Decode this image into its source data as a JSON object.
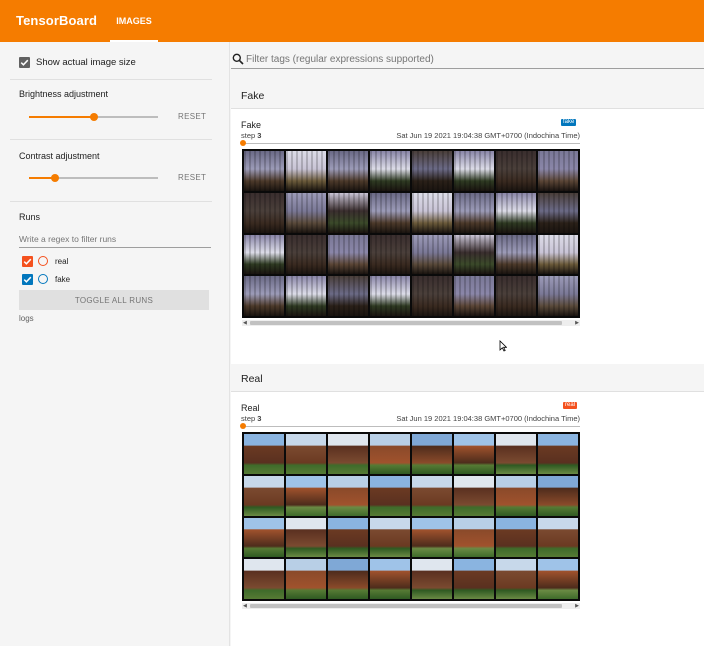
{
  "topbar": {
    "brand": "TensorBoard",
    "tab": "IMAGES"
  },
  "sidebar": {
    "show_actual_size": "Show actual image size",
    "brightness": {
      "label": "Brightness adjustment",
      "reset": "RESET",
      "value": 0.5
    },
    "contrast": {
      "label": "Contrast adjustment",
      "reset": "RESET",
      "value": 0.2
    },
    "runs_title": "Runs",
    "regex_placeholder": "Write a regex to filter runs",
    "runs": [
      {
        "name": "real",
        "color": "#f4511e"
      },
      {
        "name": "fake",
        "color": "#0277bd"
      }
    ],
    "toggle_all": "TOGGLE ALL RUNS",
    "logdir": "logs"
  },
  "main": {
    "filter_placeholder": "Filter tags (regular expressions supported)",
    "sections": [
      {
        "title": "Fake",
        "card_title": "Fake",
        "step_label": "step",
        "step_value": "3",
        "timestamp": "Sat Jun 19 2021 19:04:38 GMT+0700 (Indochina Time)",
        "run_tag": "fake",
        "run_color": "#0277bd"
      },
      {
        "title": "Real",
        "card_title": "Real",
        "step_label": "step",
        "step_value": "3",
        "timestamp": "Sat Jun 19 2021 19:04:38 GMT+0700 (Indochina Time)",
        "run_tag": "real",
        "run_color": "#f4511e"
      }
    ]
  },
  "colors": {
    "accent": "#f57c00",
    "real": "#f4511e",
    "fake": "#0277bd"
  }
}
